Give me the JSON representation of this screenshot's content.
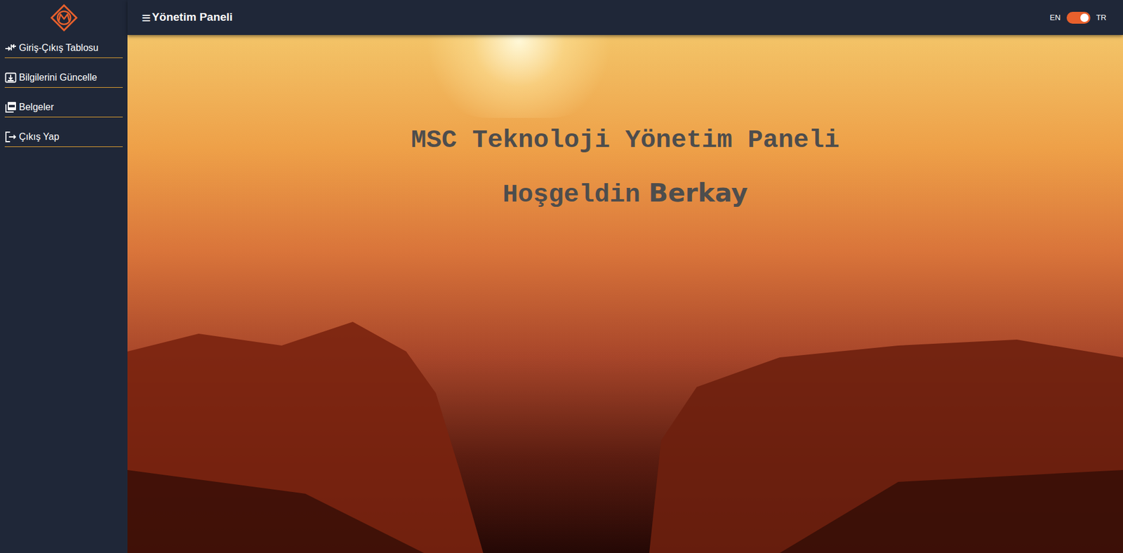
{
  "header": {
    "menu_icon": "≡",
    "title": "Yönetim Paneli",
    "language": {
      "left": "EN",
      "right": "TR",
      "on": true
    }
  },
  "sidebar": {
    "items": [
      {
        "label": "Giriş-Çıkış Tablosu",
        "icon": "inout"
      },
      {
        "label": "Bilgilerini Güncelle",
        "icon": "update"
      },
      {
        "label": "Belgeler",
        "icon": "pdf"
      },
      {
        "label": "Çıkış Yap",
        "icon": "logout"
      }
    ]
  },
  "hero": {
    "title": "MSC Teknoloji Yönetim Paneli",
    "greeting": "Hoşgeldin",
    "name": "Berkay"
  }
}
